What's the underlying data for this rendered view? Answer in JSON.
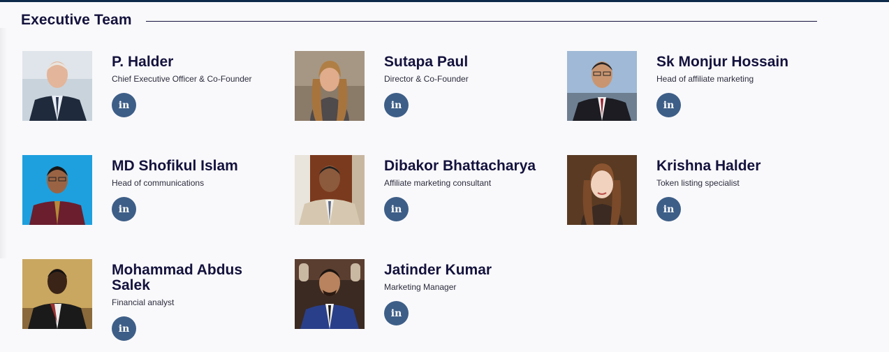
{
  "section": {
    "title": "Executive Team"
  },
  "linkedin_glyph": "in",
  "members": [
    {
      "name": "P. Halder",
      "role": "Chief Executive Officer & Co-Founder"
    },
    {
      "name": "Sutapa Paul",
      "role": "Director & Co-Founder"
    },
    {
      "name": "Sk Monjur Hossain",
      "role": "Head of affiliate marketing"
    },
    {
      "name": "MD Shofikul Islam",
      "role": "Head of communications"
    },
    {
      "name": "Dibakor Bhattacharya",
      "role": "Affiliate marketing consultant"
    },
    {
      "name": "Krishna Halder",
      "role": "Token listing specialist"
    },
    {
      "name": "Mohammad Abdus Salek",
      "role": "Financial analyst"
    },
    {
      "name": "Jatinder Kumar",
      "role": "Marketing Manager"
    }
  ],
  "colors": {
    "heading": "#14123d",
    "linkedin_button": "#3d5e87",
    "top_bar": "#0d2a4a"
  }
}
